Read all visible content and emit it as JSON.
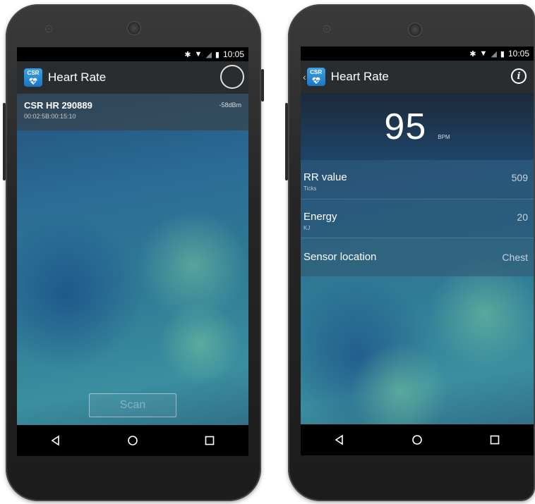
{
  "left_phone": {
    "status_bar": {
      "time": "10:05"
    },
    "action_bar": {
      "title": "Heart Rate",
      "logo_text": "CSR"
    },
    "device": {
      "name": "CSR HR 290889",
      "address": "00:02:5B:00:15:10",
      "rssi": "-58dBm"
    },
    "scan_button": "Scan",
    "nav": {
      "back_icon": "back-triangle-icon",
      "home_icon": "home-circle-icon",
      "recents_icon": "recents-square-icon"
    }
  },
  "right_phone": {
    "status_bar": {
      "time": "10:05"
    },
    "action_bar": {
      "title": "Heart Rate",
      "logo_text": "CSR",
      "back_caret": "‹",
      "info_glyph": "i"
    },
    "heart_rate": {
      "value": "95",
      "unit": "BPM"
    },
    "metrics": [
      {
        "label": "RR value",
        "sub": "Ticks",
        "value": "509"
      },
      {
        "label": "Energy",
        "sub": "KJ",
        "value": "20"
      },
      {
        "label": "Sensor location",
        "sub": "",
        "value": "Chest"
      }
    ]
  },
  "colors": {
    "action_bar": "#2a2d30",
    "logo_blue": "#1b76c4",
    "screen_bg": "#2b6c95"
  }
}
